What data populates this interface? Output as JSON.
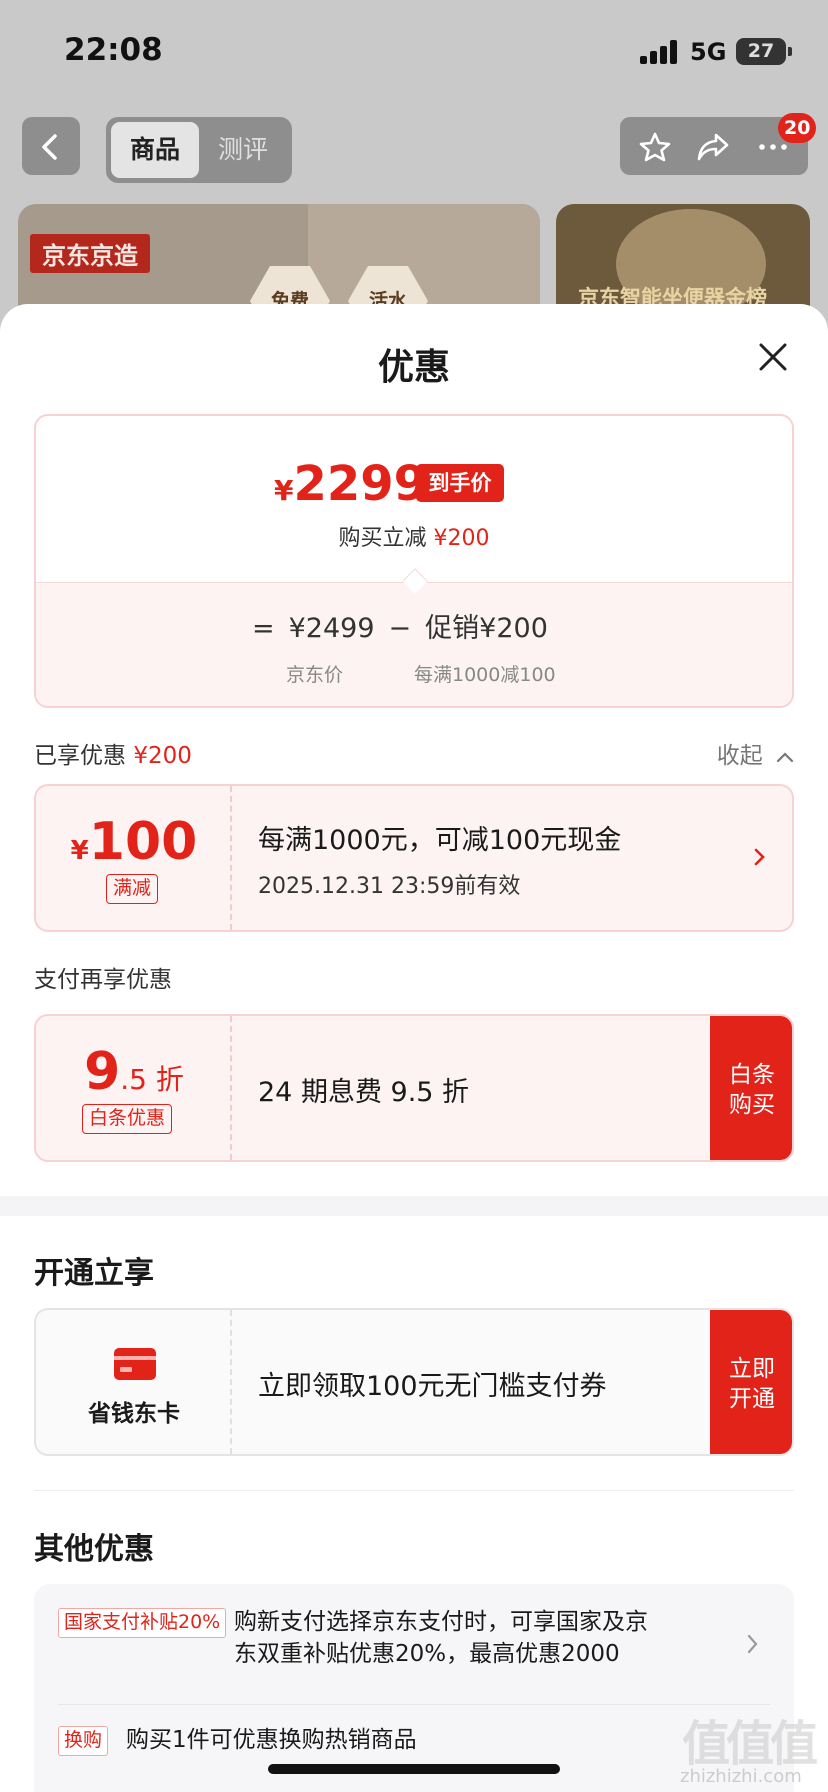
{
  "status_bar": {
    "time": "22:08",
    "network": "5G",
    "battery": "27"
  },
  "nav": {
    "tabs": [
      {
        "label": "商品",
        "active": true
      },
      {
        "label": "测评",
        "active": false
      }
    ],
    "badge_count": "20",
    "icons": [
      "back-icon",
      "star-icon",
      "share-icon",
      "more-icon"
    ]
  },
  "banner": {
    "brand_tag": "京东京造",
    "feature_1": "免费",
    "feature_2": "活水",
    "rank_text": "京东智能坐便器金榜"
  },
  "sheet": {
    "title": "优惠",
    "price_card": {
      "currency": "¥",
      "final_price": "2299",
      "final_tag": "到手价",
      "buy_reduce_label": "购买立减",
      "buy_reduce_value": "¥200",
      "equals": "=",
      "jd_price": "¥2499",
      "minus": "−",
      "promo": "促销¥200",
      "jd_price_note": "京东价",
      "promo_note": "每满1000减100"
    },
    "enjoyed": {
      "label": "已享优惠",
      "value": "¥200",
      "collapse_label": "收起"
    },
    "coupon_full_reduce": {
      "currency": "¥",
      "amount": "100",
      "tag": "满减",
      "title": "每满1000元，可减100元现金",
      "validity": "2025.12.31 23:59前有效"
    },
    "pay_more": {
      "section_label": "支付再享优惠",
      "discount_big": "9",
      "discount_small": ".5 折",
      "tag": "白条优惠",
      "desc": "24 期息费 9.5 折",
      "action_line1": "白条",
      "action_line2": "购买"
    },
    "open_enjoy": {
      "section_title": "开通立享",
      "card_name": "省钱东卡",
      "desc": "立即领取100元无门槛支付券",
      "action_line1": "立即",
      "action_line2": "开通"
    },
    "other": {
      "section_title": "其他优惠",
      "items": [
        {
          "tag": "国家支付补贴20%",
          "text_line1": "购新支付选择京东支付时，可享国家及京",
          "text_line2": "东双重补贴优惠20%，最高优惠2000"
        },
        {
          "tag": "换购",
          "text_line1": "购买1件可优惠换购热销商品"
        }
      ]
    }
  },
  "watermark": {
    "logo": "值值值",
    "url": "zhizhizhi.com"
  },
  "colors": {
    "accent": "#e2231a",
    "light_bg": "#fdf3f3",
    "border": "#f8d2d2"
  }
}
